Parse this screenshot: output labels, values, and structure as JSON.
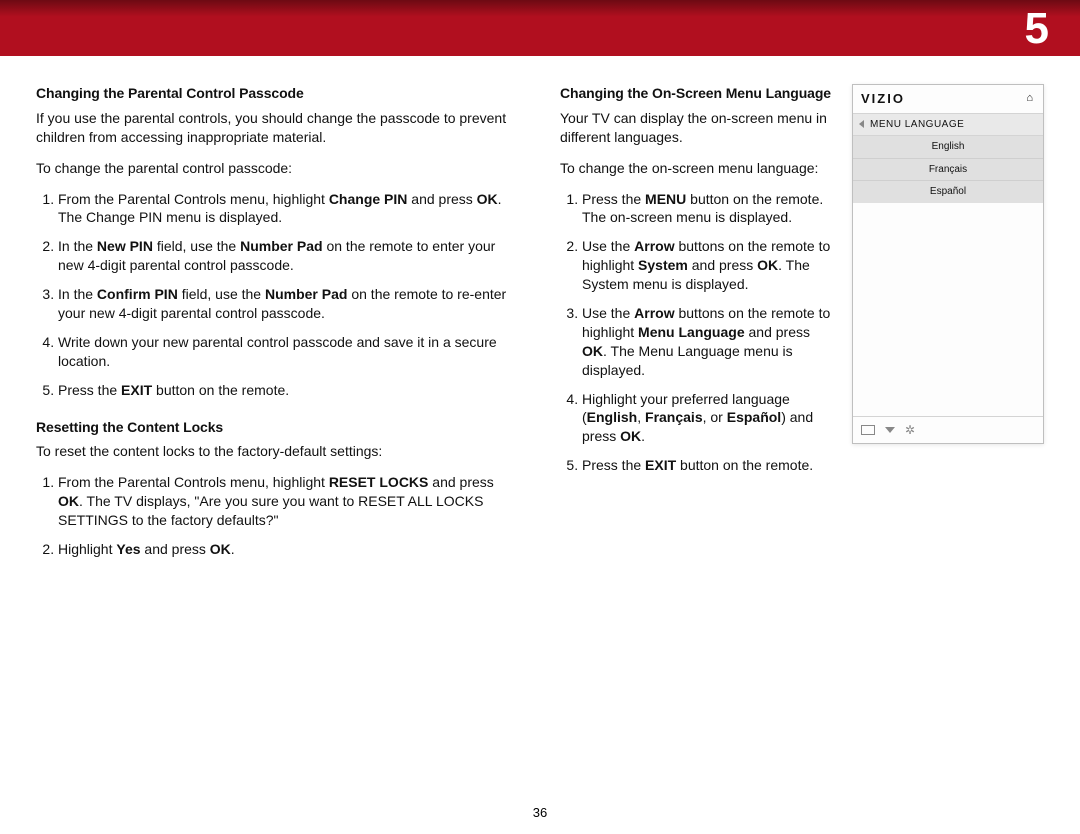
{
  "banner": {
    "chapter": "5"
  },
  "left": {
    "heading1": "Changing the Parental Control Passcode",
    "intro1": "If you use the parental controls, you should change the passcode to prevent children from accessing inappropriate material.",
    "lead1": "To change the parental control passcode:",
    "steps1": [
      {
        "pre": "From the Parental Controls menu, highlight ",
        "b1": "Change PIN",
        "mid1": " and press ",
        "b2": "OK",
        "post": ". The Change PIN menu is displayed."
      },
      {
        "pre": "In the ",
        "b1": "New PIN",
        "mid1": " field, use the ",
        "b2": "Number Pad",
        "post": " on the remote to enter your new 4-digit parental control passcode."
      },
      {
        "pre": "In the ",
        "b1": "Confirm PIN",
        "mid1": " field, use the ",
        "b2": "Number Pad",
        "post": " on the remote to re-enter your new 4-digit parental control passcode."
      },
      {
        "pre": "Write down your new parental control passcode and save it in a secure location.",
        "b1": "",
        "mid1": "",
        "b2": "",
        "post": ""
      },
      {
        "pre": "Press the ",
        "b1": "EXIT",
        "mid1": "",
        "b2": "",
        "post": " button on the remote."
      }
    ],
    "heading2": "Resetting the Content Locks",
    "lead2": "To reset the content locks to the factory-default settings:",
    "steps2": [
      {
        "pre": "From the Parental Controls menu, highlight ",
        "b1": "RESET LOCKS",
        "mid1": " and press ",
        "b2": "OK",
        "post": ". The TV displays, \"Are you sure you want to RESET ALL LOCKS SETTINGS to the factory defaults?\""
      },
      {
        "pre": "Highlight ",
        "b1": "Yes",
        "mid1": " and press ",
        "b2": "OK",
        "post": "."
      }
    ]
  },
  "right": {
    "heading": "Changing the On-Screen Menu Language",
    "intro": "Your TV can display the on-screen menu in different languages.",
    "lead": "To change the on-screen menu language:",
    "steps": [
      {
        "pre": "Press the ",
        "b1": "MENU",
        "mid1": "",
        "b2": "",
        "post": " button on the remote. The on-screen menu is displayed."
      },
      {
        "pre": "Use the ",
        "b1": "Arrow",
        "mid1": " buttons on the remote to highlight ",
        "b2": "System",
        "mid2": " and press ",
        "b3": "OK",
        "post": ". The System menu is displayed."
      },
      {
        "pre": "Use the ",
        "b1": "Arrow",
        "mid1": " buttons on the remote to highlight ",
        "b2": "Menu Language",
        "mid2": " and press ",
        "b3": "OK",
        "post": ". The Menu Language menu is displayed."
      },
      {
        "pre": "Highlight your preferred language (",
        "b1": "English",
        "mid1": ", ",
        "b2": "Français",
        "mid2": ", or ",
        "b3": "Español",
        "mid3": ") and press ",
        "b4": "OK",
        "post": "."
      },
      {
        "pre": "Press the ",
        "b1": "EXIT",
        "mid1": "",
        "b2": "",
        "post": " button on the remote."
      }
    ]
  },
  "tv": {
    "brand": "VIZIO",
    "menu_title": "MENU LANGUAGE",
    "options": [
      "English",
      "Français",
      "Español"
    ]
  },
  "page_number": "36"
}
